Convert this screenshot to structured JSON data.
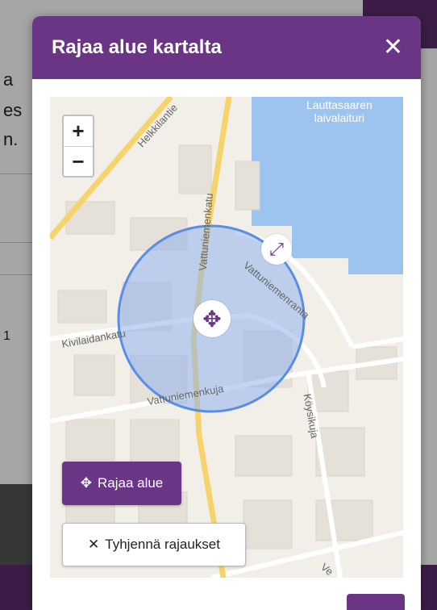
{
  "background_page": {
    "text_fragments": [
      "a",
      "es",
      "n.",
      "1"
    ]
  },
  "modal": {
    "title": "Rajaa alue kartalta",
    "close_icon": "close-icon"
  },
  "map": {
    "zoom_in": "+",
    "zoom_out": "−",
    "water_label_line1": "Lauttasaaren",
    "water_label_line2": "laivalaituri",
    "streets": {
      "helkkilantie": "Helkkilantie",
      "vattuniemenkatu": "Vattuniemenkatu",
      "vattuniemenranta": "Vattuniemenranta",
      "kivilaidankatu": "Kivilaidankatu",
      "vattuniemenkuja": "Vattuniemenkuja",
      "koysikuja": "Köysikuja",
      "ve": "Ve"
    },
    "colors": {
      "water": "#9cc4ef",
      "circle_fill": "#8fb3ec",
      "circle_stroke": "#5a8de6",
      "major_road": "#f7d46b",
      "accent": "#6b3586"
    }
  },
  "buttons": {
    "select_area": "Rajaa alue",
    "clear_selections": "Tyhjennä rajaukset"
  }
}
